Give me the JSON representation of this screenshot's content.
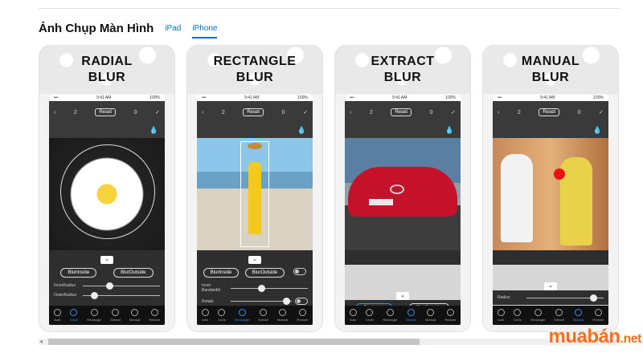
{
  "header": {
    "title": "Ảnh Chụp Màn Hình",
    "tabs": [
      "iPad",
      "iPhone"
    ]
  },
  "cards": [
    {
      "title1": "RADIAL",
      "title2": "BLUR",
      "pills": [
        "BlurInside",
        "BlurOutside"
      ],
      "sliders": [
        "InnerRadius",
        "OuterRadius"
      ]
    },
    {
      "title1": "RECTANGLE",
      "title2": "BLUR",
      "pills": [
        "BlurInside",
        "BlurOutside"
      ],
      "sliders": [
        "Inner Bandwidth",
        "Rotate"
      ]
    },
    {
      "title1": "EXTRACT",
      "title2": "BLUR",
      "pills": [
        "BlurInside",
        "BlurOutside"
      ],
      "sliders": []
    },
    {
      "title1": "MANUAL",
      "title2": "BLUR",
      "pills": [],
      "sliders": [
        "Radius"
      ]
    }
  ],
  "phone": {
    "time": "9:41 AM",
    "battery": "100%",
    "undo_count": "2",
    "redo_count": "0",
    "reset_label": "Reset"
  },
  "tabbar": [
    "Auto",
    "Circle",
    "Rectangle",
    "Extract",
    "Manual",
    "Restore"
  ],
  "watermark": {
    "main": "muabán",
    "suffix": ".net"
  }
}
